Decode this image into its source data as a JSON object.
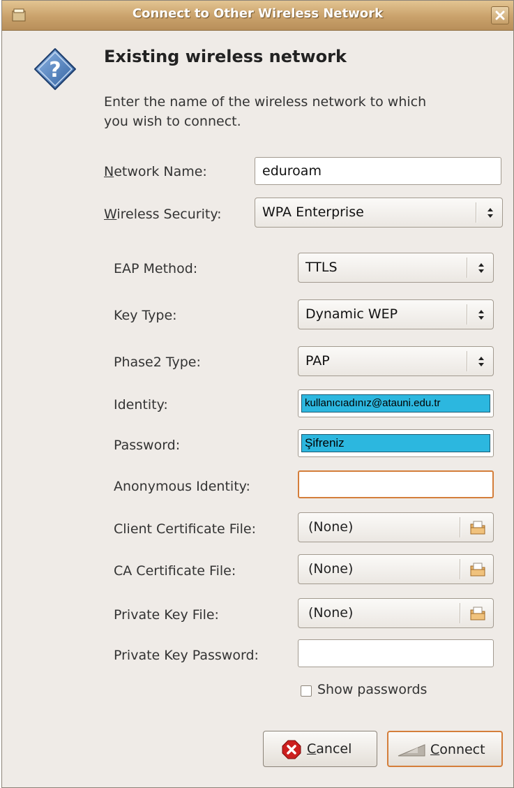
{
  "window": {
    "title": "Connect to Other Wireless Network",
    "close_icon": "close-icon",
    "app_icon": "window-menu-icon"
  },
  "header": {
    "icon": "question-help-icon",
    "heading": "Existing wireless network",
    "description": "Enter the name of the wireless network to which you wish to connect."
  },
  "network_name": {
    "label": "Network Name:",
    "value": "eduroam"
  },
  "wireless_security": {
    "label": "Wireless Security:",
    "value": "WPA Enterprise"
  },
  "eap_method": {
    "label": "EAP Method:",
    "value": "TTLS"
  },
  "key_type": {
    "label": "Key Type:",
    "value": "Dynamic WEP"
  },
  "phase2_type": {
    "label": "Phase2 Type:",
    "value": "PAP"
  },
  "identity": {
    "label": "Identity:",
    "value": "kullanıcıadınız@atauni.edu.tr"
  },
  "password": {
    "label": "Password:",
    "value": "Şifreniz"
  },
  "anonymous_identity": {
    "label": "Anonymous Identity:",
    "value": ""
  },
  "client_certificate": {
    "label": "Client Certificate File:",
    "value": "(None)",
    "icon": "open-folder-icon"
  },
  "ca_certificate": {
    "label": "CA Certificate File:",
    "value": "(None)",
    "icon": "open-folder-icon"
  },
  "private_key_file": {
    "label": "Private Key File:",
    "value": "(None)",
    "icon": "open-folder-icon"
  },
  "private_key_password": {
    "label": "Private Key Password:",
    "value": ""
  },
  "show_passwords": {
    "label": "Show passwords",
    "checked": false
  },
  "buttons": {
    "cancel": {
      "label": "Cancel",
      "icon": "cancel-icon"
    },
    "connect": {
      "label": "Connect",
      "icon": "wireless-connect-icon"
    }
  },
  "colors": {
    "titlebar": "#c9a16b",
    "focus_border": "#d47e3a",
    "highlight": "#2cb7df",
    "background": "#efebe7"
  }
}
